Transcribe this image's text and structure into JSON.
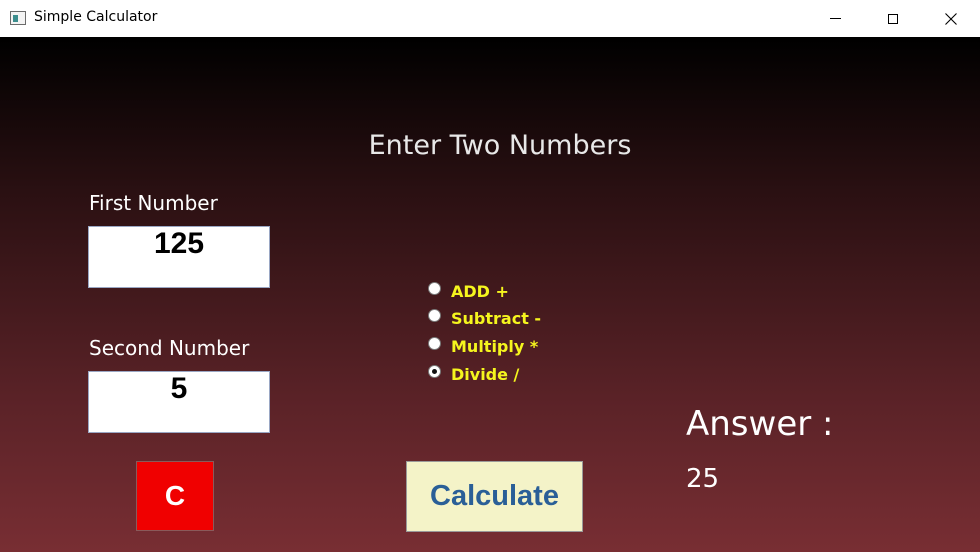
{
  "window": {
    "title": "Simple Calculator",
    "controls": {
      "minimize": "minimize-icon",
      "maximize": "maximize-icon",
      "close": "close-icon"
    }
  },
  "form": {
    "heading": "Enter Two Numbers",
    "first_label": "First Number",
    "first_value": "125",
    "second_label": "Second Number",
    "second_value": "5"
  },
  "operations": [
    {
      "label": "ADD +",
      "checked": false
    },
    {
      "label": "Subtract -",
      "checked": false
    },
    {
      "label": "Multiply *",
      "checked": false
    },
    {
      "label": "Divide /",
      "checked": true
    }
  ],
  "result": {
    "label": "Answer :",
    "value": "25"
  },
  "buttons": {
    "clear": "C",
    "calculate": "Calculate"
  },
  "colors": {
    "operation_text": "#f5f51e",
    "clear_button": "#f00000",
    "calculate_button": "#f4f3c8",
    "calculate_text": "#2a5f97"
  }
}
